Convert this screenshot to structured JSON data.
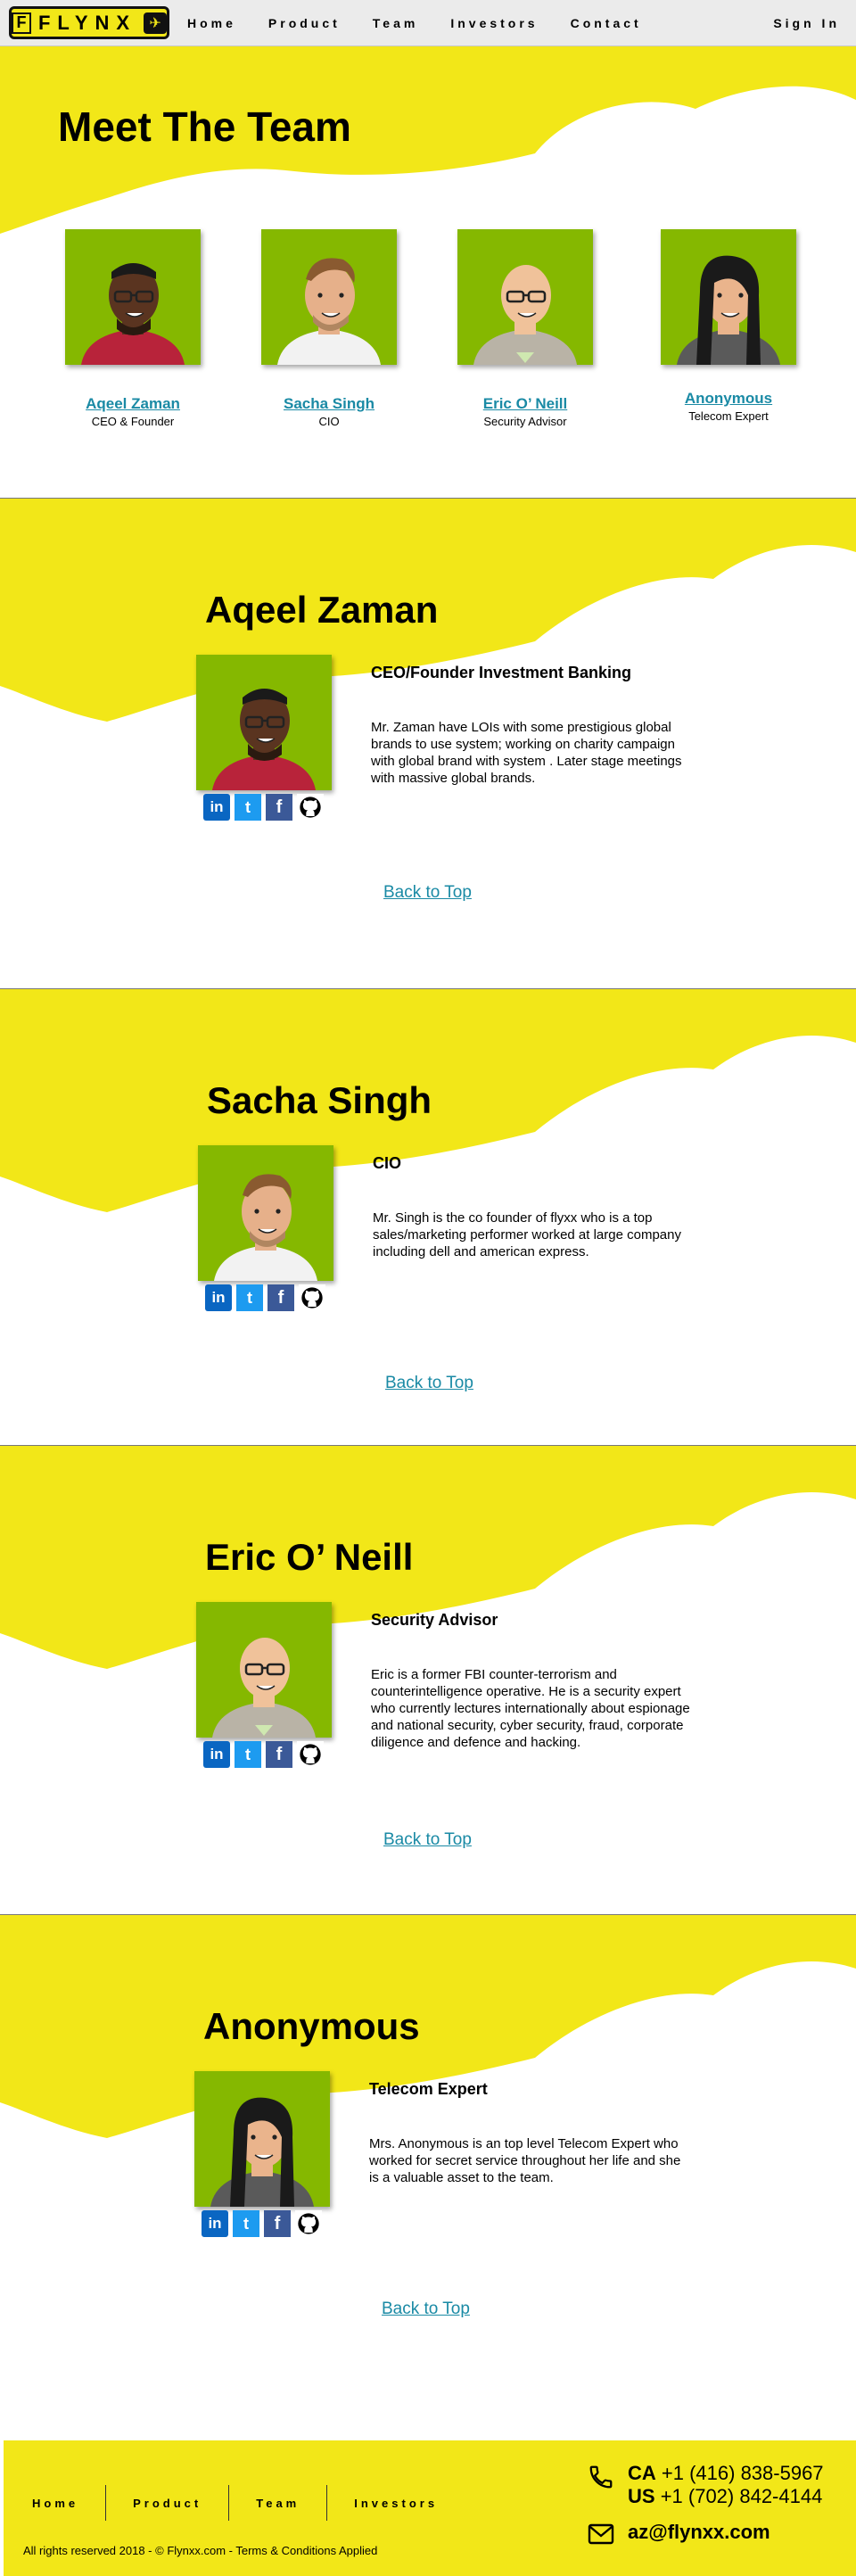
{
  "nav": {
    "logo_text": "FLYNX",
    "logo_box": "F",
    "links": [
      "Home",
      "Product",
      "Team",
      "Investors",
      "Contact"
    ],
    "sign_in": "Sign In"
  },
  "team": {
    "heading": "Meet The Team",
    "members": [
      {
        "name": "Aqeel Zaman",
        "role": "CEO & Founder"
      },
      {
        "name": "Sacha Singh",
        "role": "CIO"
      },
      {
        "name": "Eric O’ Neill",
        "role": "Security Advisor"
      },
      {
        "name": "Anonymous",
        "role": "Telecom Expert"
      }
    ]
  },
  "profiles": [
    {
      "name": "Aqeel Zaman",
      "title": "CEO/Founder Investment Banking",
      "desc": "Mr. Zaman have LOIs with some prestigious global brands to use system; working on charity campaign with global brand with system . Later stage meetings with massive global brands.",
      "back": "Back to Top"
    },
    {
      "name": "Sacha Singh",
      "title": "CIO",
      "desc": "Mr. Singh is the co founder of flyxx who is a top sales/marketing performer worked at large company including dell and american express.",
      "back": "Back to Top"
    },
    {
      "name": "Eric O’ Neill",
      "title": "Security Advisor",
      "desc": "Eric is a former FBI counter-terrorism and counterintelligence operative. He is a security expert who currently lectures internationally about espionage and national security, cyber security, fraud, corporate diligence and defence and hacking.",
      "back": "Back to Top"
    },
    {
      "name": "Anonymous",
      "title": "Telecom  Expert",
      "desc": "Mrs. Anonymous is an top level Telecom Expert who worked for secret service throughout her life and she is a valuable asset to the team.",
      "back": "Back to Top"
    }
  ],
  "social": {
    "linkedin": "in",
    "twitter": "t",
    "facebook": "f"
  },
  "footer": {
    "links": [
      "Home",
      "Product",
      "Team",
      "Investors"
    ],
    "copyright": "All rights reserved 2018 - © Flynxx.com - Terms & Conditions Applied",
    "ca_label": "CA",
    "ca_phone": "+1 (416) 838-5967",
    "us_label": "US",
    "us_phone": "+1 (702) 842-4144",
    "email": "az@flynxx.com"
  },
  "colors": {
    "brand_yellow": "#f2e718",
    "link_teal": "#1a8aa5",
    "avatar_green": "#85b800"
  }
}
